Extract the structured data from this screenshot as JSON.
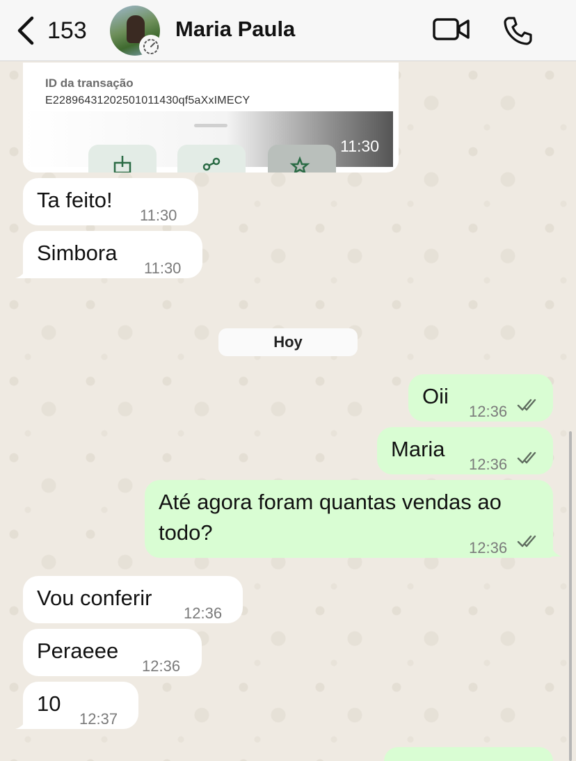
{
  "header": {
    "back_count": "153",
    "contact_name": "Maria Paula"
  },
  "transaction_card": {
    "label": "ID da transação",
    "id": "E2289643120250101143​0qf5aXxIMECY",
    "time": "11:30"
  },
  "day_separator": "Hoy",
  "messages": [
    {
      "dir": "in",
      "text": "Ta feito!",
      "time": "11:30"
    },
    {
      "dir": "in",
      "text": "Simbora",
      "time": "11:30"
    },
    {
      "dir": "out",
      "text": "Oii",
      "time": "12:36",
      "status": "read"
    },
    {
      "dir": "out",
      "text": "Maria",
      "time": "12:36",
      "status": "read"
    },
    {
      "dir": "out",
      "text_line1": "Até agora foram quantas vendas ao",
      "text_line2": "todo?",
      "time": "12:36",
      "status": "read"
    },
    {
      "dir": "in",
      "text": "Vou conferir",
      "time": "12:36"
    },
    {
      "dir": "in",
      "text": "Peraeee",
      "time": "12:36"
    },
    {
      "dir": "in",
      "text": "10",
      "time": "12:37"
    }
  ],
  "colors": {
    "incoming_bubble": "#ffffff",
    "outgoing_bubble": "#d9fdd3",
    "ticks_read": "#5e6b5e"
  }
}
